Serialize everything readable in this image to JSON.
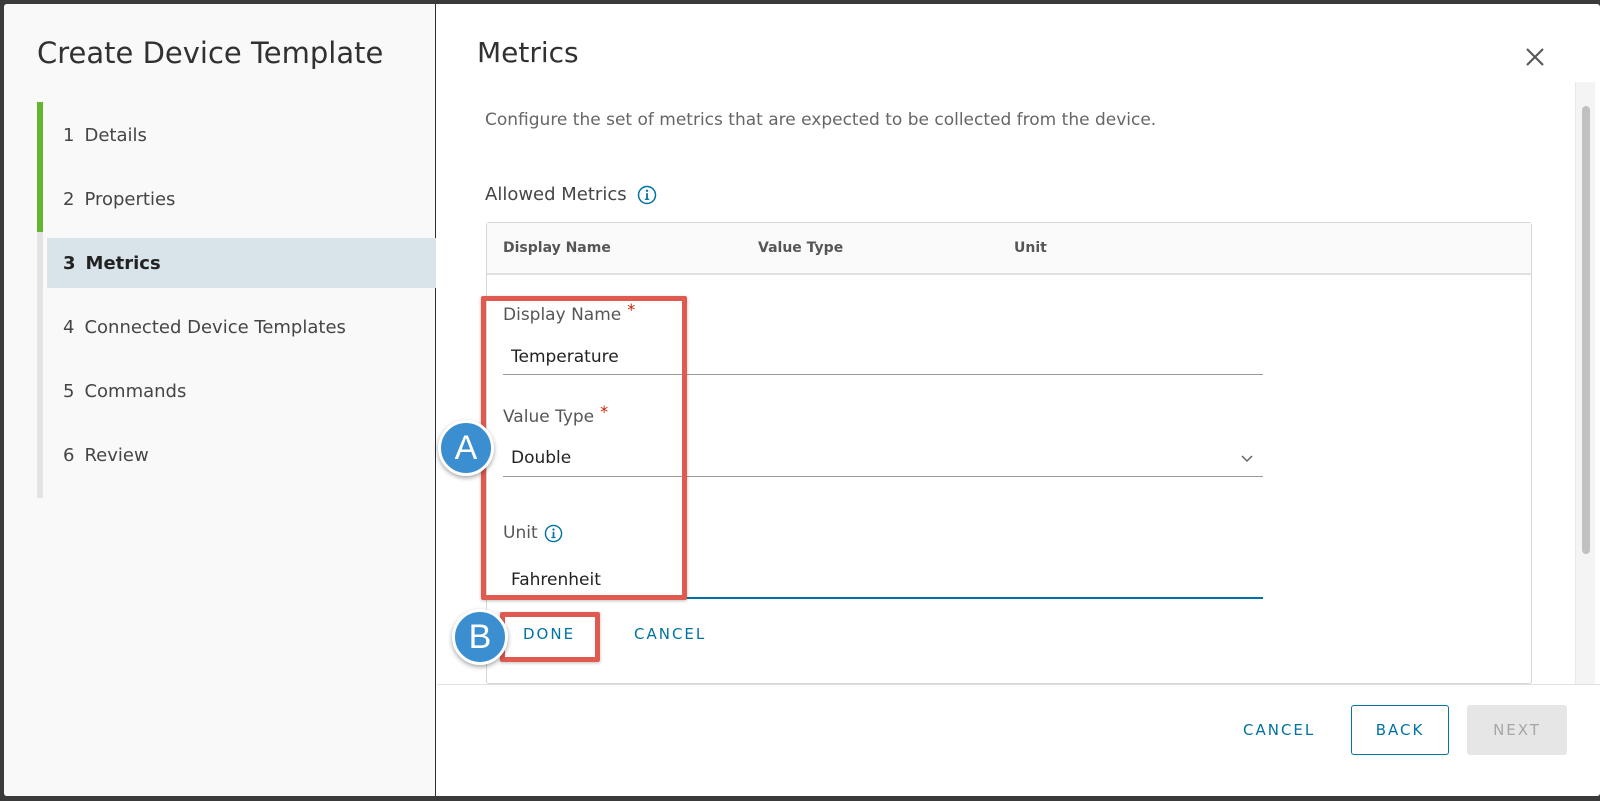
{
  "wizard": {
    "title": "Create Device Template",
    "steps": [
      {
        "num": "1",
        "label": "Details",
        "state": "done"
      },
      {
        "num": "2",
        "label": "Properties",
        "state": "done"
      },
      {
        "num": "3",
        "label": "Metrics",
        "state": "active"
      },
      {
        "num": "4",
        "label": "Connected Device Templates",
        "state": "todo"
      },
      {
        "num": "5",
        "label": "Commands",
        "state": "todo"
      },
      {
        "num": "6",
        "label": "Review",
        "state": "todo"
      }
    ]
  },
  "panel": {
    "title": "Metrics",
    "description": "Configure the set of metrics that are expected to be collected from the device.",
    "section_label": "Allowed Metrics",
    "grid_columns": [
      "Display Name",
      "Value Type",
      "Unit"
    ],
    "form": {
      "display_name": {
        "label": "Display Name",
        "required_mark": "*",
        "value": "Temperature"
      },
      "value_type": {
        "label": "Value Type",
        "required_mark": "*",
        "value": "Double"
      },
      "unit": {
        "label": "Unit",
        "value": "Fahrenheit"
      },
      "done_label": "DONE",
      "cancel_label": "CANCEL"
    }
  },
  "footer": {
    "cancel_label": "CANCEL",
    "back_label": "BACK",
    "next_label": "NEXT"
  },
  "annotations": {
    "a": "A",
    "b": "B"
  },
  "colors": {
    "accent": "#0072a3",
    "step_done": "#62b72c",
    "active_step_bg": "#d9e4ea",
    "callout": "#e05a4f",
    "marker": "#3b8fd0",
    "required": "#c92100"
  }
}
